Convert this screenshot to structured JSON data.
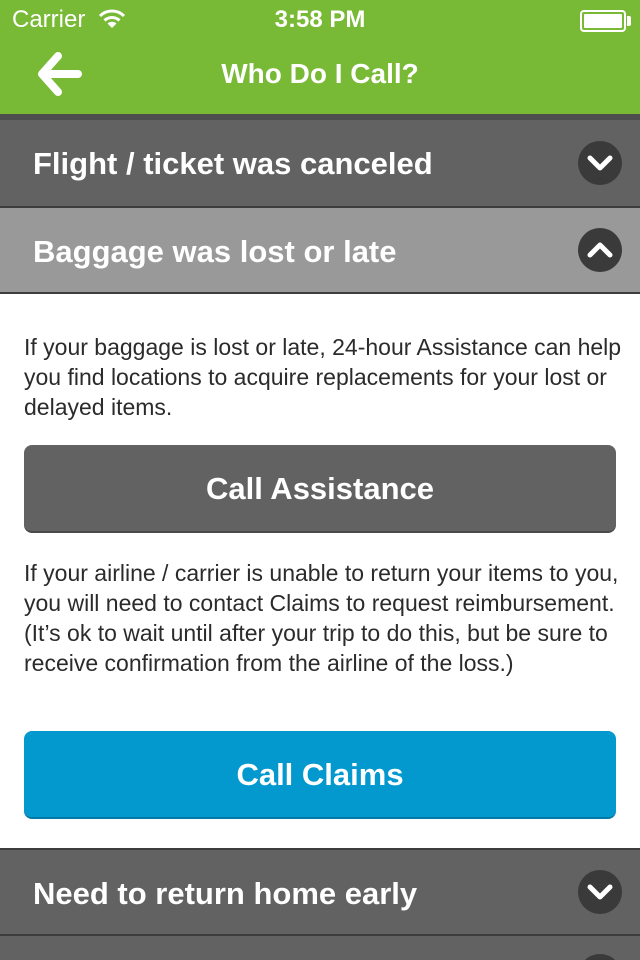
{
  "status_bar": {
    "carrier": "Carrier",
    "time": "3:58 PM",
    "battery_level": 1.0
  },
  "nav": {
    "title": "Who Do I Call?",
    "back_icon": "back-arrow-icon"
  },
  "sections": [
    {
      "label": "Flight / ticket was canceled",
      "state": "collapsed",
      "icon": "chevron-down-icon"
    },
    {
      "label": "Baggage was lost or late",
      "state": "expanded",
      "icon": "chevron-up-icon"
    },
    {
      "label": "Need to return home early",
      "state": "collapsed",
      "icon": "chevron-down-icon"
    }
  ],
  "content": {
    "paragraph1": "If your baggage is lost or late, 24-hour Assistance can help you find locations to acquire replacements for your lost or delayed items.",
    "assistance_button": "Call Assistance",
    "paragraph2": "If your airline / carrier is unable to return your items to you, you will need to contact Claims to request reimbursement. (It’s ok to wait until after your trip to do this, but be sure to receive confirmation from the airline of the loss.)",
    "claims_button": "Call Claims"
  },
  "colors": {
    "brand_green": "#78b935",
    "header_dark": "#626262",
    "header_expanded": "#999999",
    "claims_blue": "#0399cf"
  }
}
